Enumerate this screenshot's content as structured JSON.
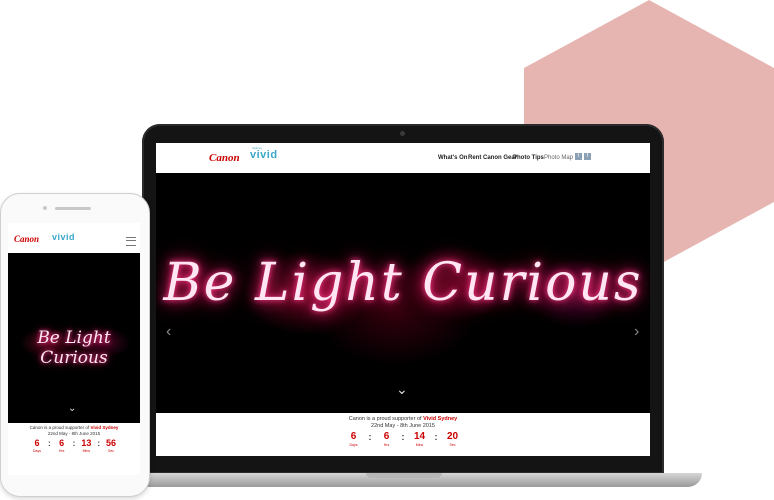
{
  "brand": {
    "canon": "Canon",
    "vivid": "vivid",
    "vivid_tag": "Sydney",
    "accent": "#cc0000",
    "vivid_color": "#3aa6c8",
    "hexagon_color": "#e2a8a4"
  },
  "nav": {
    "links": [
      "What's On",
      "Rent Canon Gear",
      "Photo Tips",
      "Photo Map"
    ],
    "social": [
      "twitter-icon",
      "facebook-icon"
    ]
  },
  "hero": {
    "headline": "Be Light Curious",
    "prev_icon": "‹",
    "next_icon": "›",
    "scroll_icon": "⌄"
  },
  "footer": {
    "supporter_prefix": "Canon is a proud supporter of",
    "supporter_event": "Vivid Sydney",
    "dates": "22nd May - 8th June 2015"
  },
  "countdown_laptop": [
    {
      "value": "6",
      "unit": "Days"
    },
    {
      "value": "6",
      "unit": "Hrs"
    },
    {
      "value": "14",
      "unit": "Mins"
    },
    {
      "value": "20",
      "unit": "Sec"
    }
  ],
  "countdown_phone": [
    {
      "value": "6",
      "unit": "Days"
    },
    {
      "value": "6",
      "unit": "Hrs"
    },
    {
      "value": "13",
      "unit": "Mins"
    },
    {
      "value": "56",
      "unit": "Sec"
    }
  ],
  "separator": ":"
}
